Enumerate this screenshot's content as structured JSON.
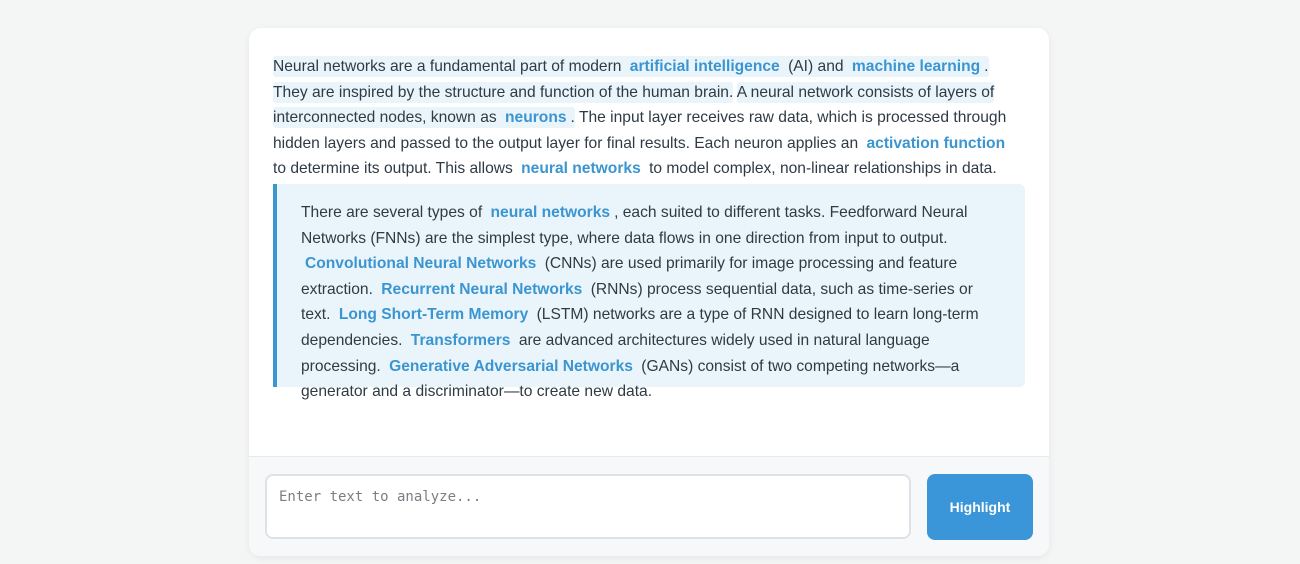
{
  "colors": {
    "page_background": "#f4f5f5",
    "card_background": "#ffffff",
    "highlight_background": "#eaf4fb",
    "keyword": "#3b95d0",
    "button": "#3b95d9"
  },
  "article": {
    "paragraph1": {
      "s1_a": "Neural networks are a fundamental part of modern",
      "kw_ai": "artificial intelligence",
      "s1_b": "(AI) and",
      "kw_ml": "machine learning",
      "s1_end": ".",
      "s2": "They are inspired by the structure and function of the human brain.",
      "s3_a": "A neural network consists of layers of interconnected nodes, known as",
      "kw_neurons": "neurons",
      "s3_end": ".",
      "s4_a": "The input layer receives raw data, which is processed through hidden layers and passed to the output layer for final results. Each neuron applies an",
      "kw_activation": "activation function",
      "s4_b": "to determine its output. This allows",
      "kw_nn": "neural networks",
      "s4_c": "to model complex, non-linear relationships in data."
    },
    "blockquote": {
      "a": "There are several types of",
      "kw_nn": "neural networks",
      "b": ", each suited to different tasks. Feedforward Neural Networks (FNNs) are the simplest type, where data flows in one direction from input to output.",
      "kw_cnn": "Convolutional Neural Networks",
      "c": "(CNNs) are used primarily for image processing and feature extraction.",
      "kw_rnn": "Recurrent Neural Networks",
      "d": "(RNNs) process sequential data, such as time-series or text.",
      "kw_lstm": "Long Short-Term Memory",
      "e": "(LSTM) networks are a type of RNN designed to learn long-term dependencies.",
      "kw_transformers": "Transformers",
      "f": "are advanced architectures widely used in natural language processing.",
      "kw_gan": "Generative Adversarial Networks",
      "g": "(GANs) consist of two competing networks—a generator and a discriminator—to create new data."
    }
  },
  "input_bar": {
    "placeholder": "Enter text to analyze...",
    "value": "",
    "button_label": "Highlight"
  }
}
